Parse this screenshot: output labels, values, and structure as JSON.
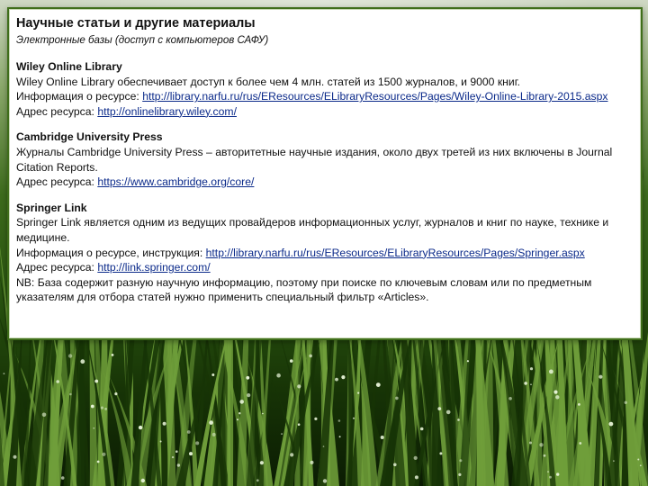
{
  "header": {
    "title": "Научные статьи и другие материалы",
    "subtitle": "Электронные базы (доступ с компьютеров САФУ)"
  },
  "sections": [
    {
      "heading": "Wiley Online Library",
      "desc": "Wiley Online Library обеспечивает доступ к более чем 4 млн. статей из 1500 журналов, и 9000 книг.",
      "info_label": "Информация о ресурсе: ",
      "info_url": "http://library.narfu.ru/rus/EResources/ELibraryResources/Pages/Wiley-Online-Library-2015.aspx",
      "addr_label": "Адрес ресурса: ",
      "addr_url": "http://onlinelibrary.wiley.com/"
    },
    {
      "heading": "Cambridge University Press",
      "desc": "Журналы Cambridge University Press – авторитетные научные издания, около двух третей из них включены в Journal Citation Reports.",
      "addr_label": "Адрес ресурса: ",
      "addr_url": "https://www.cambridge.org/core/"
    },
    {
      "heading": "Springer Link",
      "desc": "Springer Link является одним из ведущих провайдеров информационных услуг, журналов и книг по науке, технике и медицине.",
      "info_label": "Информация о ресурсе, инструкция: ",
      "info_url": "http://library.narfu.ru/rus/EResources/ELibraryResources/Pages/Springer.aspx",
      "addr_label": "Адрес ресурса: ",
      "addr_url": "http://link.springer.com/",
      "note": "NB: База содержит разную научную информацию, поэтому при поиске по ключевым словам или по предметным указателям для отбора статей нужно применить специальный фильтр «Articles»."
    }
  ],
  "colors": {
    "link": "#0b2a8a",
    "panel_border": "#3f6e1a",
    "grass_dark": "#173406",
    "grass_light": "#6f9e3a"
  }
}
